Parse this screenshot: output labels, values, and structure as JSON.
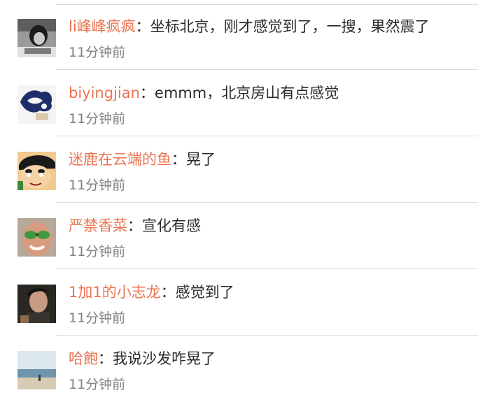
{
  "comments": [
    {
      "username": "li峰峰疯疯",
      "separator": "：",
      "text": "坐标北京，刚才感觉到了，一搜，果然震了",
      "time": "11分钟前",
      "avatar_icon": "grayscale-portrait-avatar"
    },
    {
      "username": "biyingjian",
      "separator": "：",
      "text": "emmm，北京房山有点感觉",
      "time": "11分钟前",
      "avatar_icon": "blue-ink-map-avatar"
    },
    {
      "username": "迷鹿在云端的鱼",
      "separator": "：",
      "text": "晃了",
      "time": "11分钟前",
      "avatar_icon": "cartoon-boy-avatar"
    },
    {
      "username": "严禁香菜",
      "separator": "：",
      "text": "宣化有感",
      "time": "11分钟前",
      "avatar_icon": "green-sunglasses-face-avatar"
    },
    {
      "username": "1加1的小志龙",
      "separator": "：",
      "text": "感觉到了",
      "time": "11分钟前",
      "avatar_icon": "dark-portrait-avatar"
    },
    {
      "username": "哈飽",
      "separator": "：",
      "text": "我说沙发咋晃了",
      "time": "11分钟前",
      "avatar_icon": "beach-scene-avatar"
    }
  ],
  "colors": {
    "username": "#eb7350",
    "text": "#2b2b2b",
    "timestamp": "#808080",
    "divider": "#dcdcdc"
  }
}
